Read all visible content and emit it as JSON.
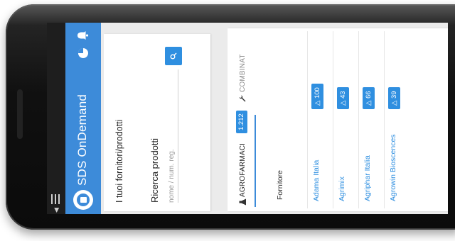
{
  "app": {
    "title": "SDS OnDemand"
  },
  "search_card": {
    "heading": "I tuoi fornitori/prodotti",
    "search_label": "Ricerca prodotti",
    "search_placeholder": "nome / num. reg.",
    "search_value": ""
  },
  "tabs": [
    {
      "label": "AGROFARMACI",
      "badge": "1.212",
      "icon": "flask-icon",
      "active": true
    },
    {
      "label": "COMBINAT",
      "icon": "wrench-icon",
      "active": false
    }
  ],
  "table": {
    "column_header": "Fornitore",
    "rows": [
      {
        "name": "Adama Italia",
        "count": "100"
      },
      {
        "name": "Agrimix",
        "count": "43"
      },
      {
        "name": "Agriphar Italia",
        "count": "66"
      },
      {
        "name": "Agrowin Bioscences",
        "count": "39"
      }
    ]
  },
  "colors": {
    "primary": "#3d8bd9",
    "button": "#2f8fe0",
    "statusbar": "#1e1e1e"
  }
}
